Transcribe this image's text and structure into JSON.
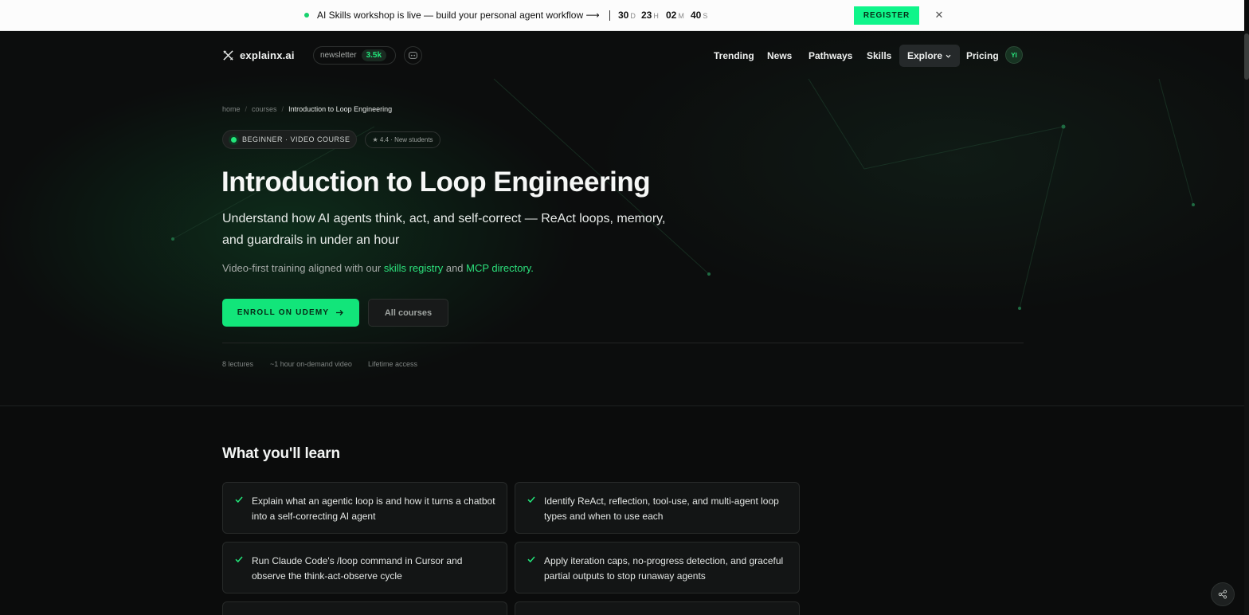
{
  "announcement": {
    "message": "AI Skills workshop is live — build your personal agent workflow ⟶",
    "countdown": [
      {
        "value": "30",
        "unit": "D"
      },
      {
        "value": "23",
        "unit": "H"
      },
      {
        "value": "02",
        "unit": "M"
      },
      {
        "value": "40",
        "unit": "S"
      }
    ],
    "register_label": "REGISTER",
    "close_glyph": "✕"
  },
  "nav": {
    "brand": "explainx.ai",
    "newsletter_label": "newsletter",
    "newsletter_count": "3.5k",
    "links": {
      "trending": "Trending",
      "news": "News",
      "pathways": "Pathways",
      "skills": "Skills",
      "explore": "Explore",
      "pricing": "Pricing"
    },
    "avatar_initials": "YI"
  },
  "breadcrumb": {
    "home": "home",
    "courses": "courses",
    "current": "Introduction to Loop Engineering"
  },
  "badges": {
    "level": "BEGINNER · VIDEO COURSE",
    "rating": "★ 4.4 · New students"
  },
  "hero": {
    "title": "Introduction to Loop Engineering",
    "subtitle": "Understand how AI agents think, act, and self-correct — ReAct loops, memory, and guardrails in under an hour",
    "support_prefix": "Video-first training aligned with our ",
    "support_link1": "skills registry",
    "support_mid": " and ",
    "support_link2": "MCP directory."
  },
  "cta": {
    "enroll_label": "ENROLL ON UDEMY",
    "all_courses_label": "All courses"
  },
  "meta": {
    "lectures": "8 lectures",
    "duration": "~1 hour on-demand video",
    "access": "Lifetime access"
  },
  "learn": {
    "title": "What you'll learn",
    "items": [
      "Explain what an agentic loop is and how it turns a chatbot into a self-correcting AI agent",
      "Identify ReAct, reflection, tool-use, and multi-agent loop types and when to use each",
      "Run Claude Code's /loop command in Cursor and observe the think-act-observe cycle",
      "Apply iteration caps, no-progress detection, and graceful partial outputs to stop runaway agents"
    ]
  },
  "icons": {
    "logo": "x-logo-icon",
    "discord": "discord-icon",
    "check": "check-icon",
    "share": "share-icon",
    "arrow": "arrow-right-icon",
    "chevron": "chevron-down-icon"
  },
  "colors": {
    "accent": "#12e57a",
    "background": "#0b0c0c",
    "announcement_bg": "#fcfcfc"
  }
}
